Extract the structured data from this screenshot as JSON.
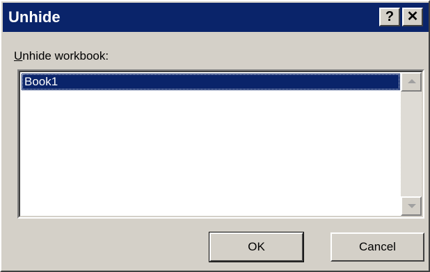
{
  "window": {
    "title": "Unhide",
    "help_label": "?",
    "close_label": "✕"
  },
  "dialog": {
    "label_prefix": "U",
    "label_rest": "nhide workbook:",
    "list_items": [
      "Book1"
    ],
    "selected_index": 0
  },
  "buttons": {
    "ok_label": "OK",
    "cancel_label": "Cancel"
  },
  "colors": {
    "titlebar": "#0a246a",
    "selection": "#0a246a",
    "face": "#d4d0c8"
  }
}
